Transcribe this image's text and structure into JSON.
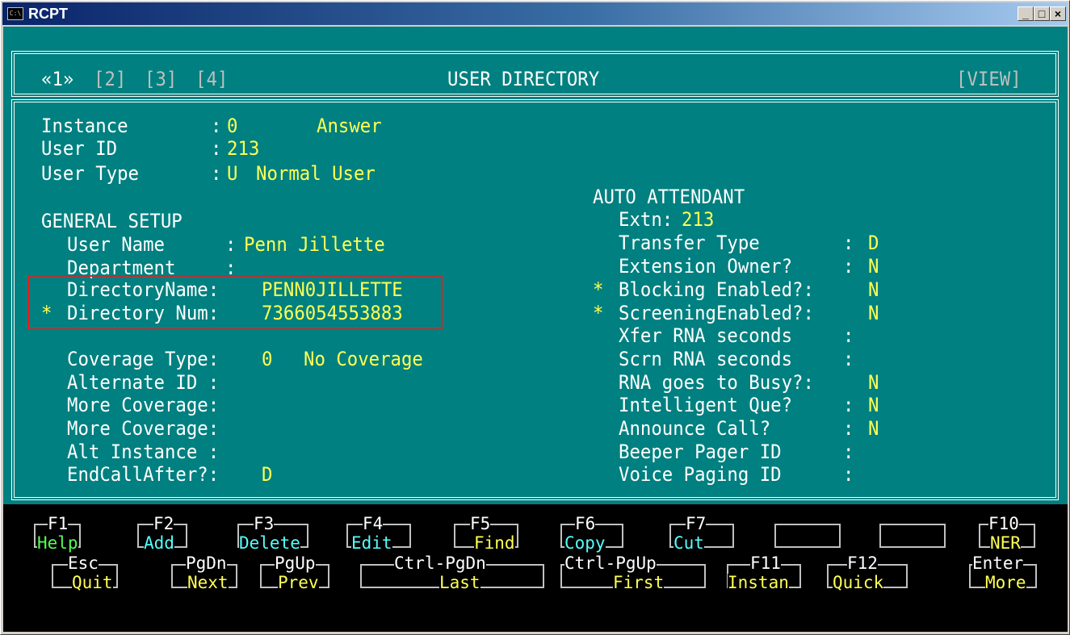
{
  "window": {
    "title": "RCPT",
    "icon": "console-icon",
    "minimize_label": "_",
    "maximize_label": "□",
    "close_label": "×"
  },
  "header": {
    "pages": [
      "«1»",
      "[2]",
      "[3]",
      "[4]"
    ],
    "title": "USER DIRECTORY",
    "mode": "[VIEW]"
  },
  "info": {
    "instance_label": "Instance",
    "instance_sep": ":",
    "instance_value": "0",
    "instance_desc": "Answer",
    "userid_label": "User ID",
    "userid_sep": ":",
    "userid_value": "213",
    "usertype_label": "User Type",
    "usertype_sep": ":",
    "usertype_value": "U",
    "usertype_desc": "Normal User"
  },
  "general": {
    "heading": "GENERAL SETUP",
    "user_name_label": "User Name",
    "user_name_sep": ":",
    "user_name_value": "Penn Jillette",
    "department_label": "Department",
    "department_sep": ":",
    "department_value": "",
    "dir_name_label": "DirectoryName:",
    "dir_name_value": "PENN0JILLETTE",
    "dir_num_marker": "*",
    "dir_num_label": "Directory Num:",
    "dir_num_value": "7366054553883",
    "coverage_type_label": "Coverage Type:",
    "coverage_type_value": "0",
    "coverage_type_desc": "No Coverage",
    "alternate_id_label": "Alternate ID :",
    "alternate_id_value": "",
    "more_coverage_1_label": "More Coverage:",
    "more_coverage_1_value": "",
    "more_coverage_2_label": "More Coverage:",
    "more_coverage_2_value": "",
    "alt_instance_label": "Alt Instance :",
    "alt_instance_value": "",
    "end_call_label": "EndCallAfter?:",
    "end_call_value": "D"
  },
  "auto": {
    "heading": "AUTO ATTENDANT",
    "extn_label": "Extn:",
    "extn_value": "213",
    "transfer_type_label": "Transfer Type",
    "transfer_type_sep": ":",
    "transfer_type_value": "D",
    "ext_owner_label": "Extension Owner?",
    "ext_owner_sep": ":",
    "ext_owner_value": "N",
    "blocking_marker": "*",
    "blocking_label": "Blocking Enabled?:",
    "blocking_value": "N",
    "screening_marker": "*",
    "screening_label": "ScreeningEnabled?:",
    "screening_value": "N",
    "xfer_rna_label": "Xfer RNA seconds",
    "xfer_rna_sep": ":",
    "xfer_rna_value": "",
    "scrn_rna_label": "Scrn RNA seconds",
    "scrn_rna_sep": ":",
    "scrn_rna_value": "",
    "rna_busy_label": "RNA goes to Busy?:",
    "rna_busy_value": "N",
    "intel_que_label": "Intelligent Que?",
    "intel_que_sep": ":",
    "intel_que_value": "N",
    "announce_label": "Announce Call?",
    "announce_sep": ":",
    "announce_value": "N",
    "beeper_label": "Beeper Pager ID",
    "beeper_sep": ":",
    "beeper_value": "",
    "voice_paging_label": "Voice Paging ID",
    "voice_paging_sep": ":",
    "voice_paging_value": ""
  },
  "fkeys_row1": [
    {
      "key": "F1",
      "action": "Help"
    },
    {
      "key": "F2",
      "action": "Add"
    },
    {
      "key": "F3",
      "action": "Delete"
    },
    {
      "key": "F4",
      "action": "Edit"
    },
    {
      "key": "F5",
      "action": "Find"
    },
    {
      "key": "F6",
      "action": "Copy"
    },
    {
      "key": "F7",
      "action": "Cut"
    },
    {
      "key": "",
      "action": ""
    },
    {
      "key": "",
      "action": ""
    },
    {
      "key": "F10",
      "action": "NER"
    }
  ],
  "fkeys_row2": [
    {
      "key": "Esc",
      "action": "Quit"
    },
    {
      "key": "PgDn",
      "action": "Next"
    },
    {
      "key": "PgUp",
      "action": "Prev"
    },
    {
      "key": "Ctrl-PgDn",
      "action": "Last"
    },
    {
      "key": "Ctrl-PgUp",
      "action": "First"
    },
    {
      "key": "F11",
      "action": "Instan"
    },
    {
      "key": "F12",
      "action": "Quick"
    },
    {
      "key": "Enter",
      "action": "More"
    }
  ],
  "colors": {
    "background": "#008080",
    "value": "#ffff55",
    "label": "#ffffff",
    "highlight": "#e02020"
  }
}
